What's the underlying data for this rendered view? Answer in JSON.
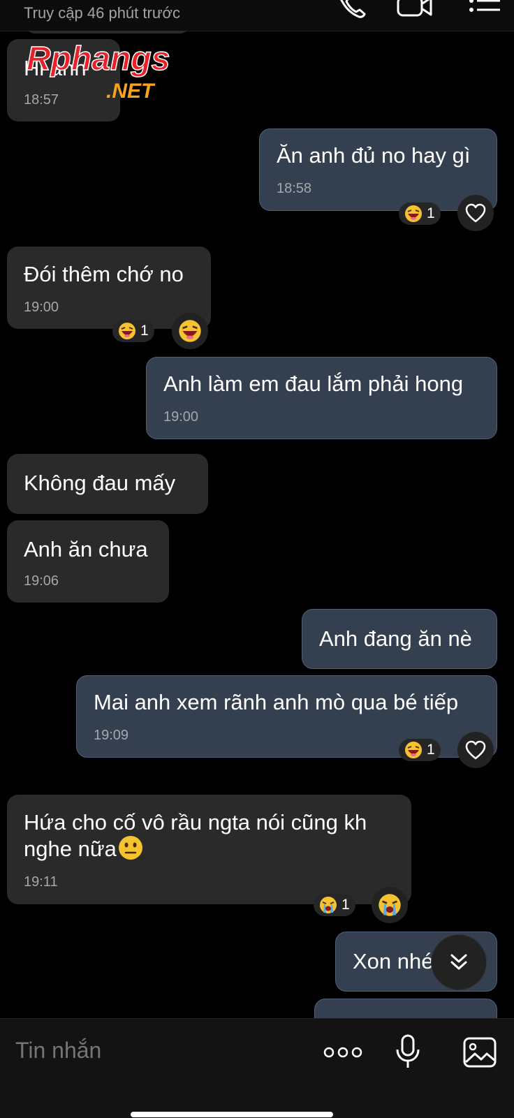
{
  "header": {
    "status": "Truy cập 46 phút trước"
  },
  "watermark": {
    "brand": "Rphangs",
    "suffix": ".NET"
  },
  "messages": [
    {
      "text": "Hi anh",
      "time": "18:57"
    },
    {
      "text": "Ăn anh đủ no hay gì",
      "time": "18:58",
      "reaction_count": "1"
    },
    {
      "text": "Đói thêm chớ no",
      "time": "19:00",
      "reaction_count": "1"
    },
    {
      "text": "Anh làm em đau lắm phải hong",
      "time": "19:00"
    },
    {
      "text": "Không đau mấy"
    },
    {
      "text": "Anh ăn chưa",
      "time": "19:06"
    },
    {
      "text": "Anh đang ăn nè"
    },
    {
      "text": "Mai anh xem rãnh anh mò qua bé tiếp",
      "time": "19:09",
      "reaction_count": "1"
    },
    {
      "text": "Hứa cho cố vô rầu ngta nói cũng kh",
      "text2": "nghe nữa",
      "time": "19:11",
      "reaction_count": "1"
    },
    {
      "text": "Xon nhé"
    }
  ],
  "composer": {
    "placeholder": "Tin nhắn"
  },
  "icons": {
    "call": "phone-icon",
    "video": "video-icon",
    "menu": "menu-icon",
    "heart": "heart-icon",
    "laugh": "laughing-emoji",
    "cry": "crying-emoji",
    "neutral": "neutral-face-emoji",
    "more": "more-dots-icon",
    "mic": "microphone-icon",
    "image": "image-icon",
    "scroll": "chevron-double-down-icon"
  },
  "colors": {
    "incoming_bubble": "#2a2a2a",
    "outgoing_bubble": "#34404f",
    "outgoing_border": "#50607a",
    "watermark_red": "#e8202a",
    "watermark_orange": "#f7a31c"
  }
}
